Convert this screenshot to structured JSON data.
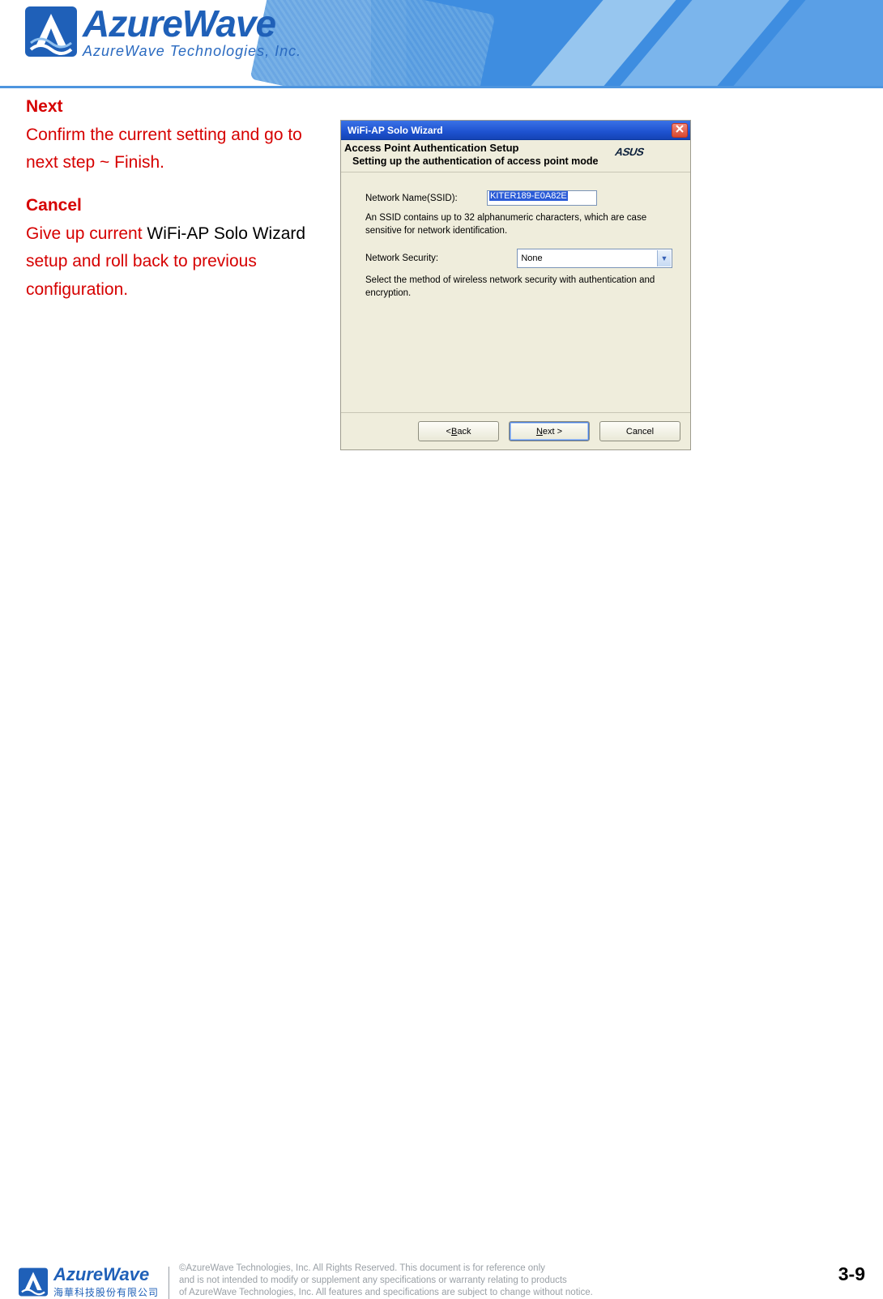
{
  "header": {
    "brand_big": "AzureWave",
    "brand_sub": "AzureWave  Technologies,  Inc."
  },
  "doc": {
    "next_title": "Next",
    "next_body": "Confirm the current setting and go to next step ~ Finish.",
    "cancel_title": "Cancel",
    "cancel_body_red1": "Give up current ",
    "cancel_body_black": "WiFi-AP Solo Wizard",
    "cancel_body_red2": " setup and roll back to previous configuration."
  },
  "dialog": {
    "title": "WiFi-AP Solo Wizard",
    "heading": "Access Point Authentication Setup",
    "subheading": "Setting up the authentication of access point mode",
    "ssid_label": "Network Name(SSID):",
    "ssid_value": "KITER189-E0A82E",
    "ssid_hint": "An SSID contains up to 32 alphanumeric characters, which are case sensitive for network identification.",
    "security_label": "Network Security:",
    "security_value": "None",
    "security_hint": "Select the method of wireless network security with authentication and encryption.",
    "buttons": {
      "back_pre": "< ",
      "back_u": "B",
      "back_post": "ack",
      "next_u": "N",
      "next_post": "ext >",
      "cancel": "Cancel"
    }
  },
  "footer": {
    "brand_big": "AzureWave",
    "brand_cn": "海華科技股份有限公司",
    "legal1": "©AzureWave Technologies, Inc. All Rights Reserved. This document is for reference only",
    "legal2": "and is not intended to modify or supplement any specifications or  warranty relating to products",
    "legal3": "of AzureWave Technologies, Inc.  All features and specifications are subject to change without notice.",
    "page": "3-9"
  }
}
